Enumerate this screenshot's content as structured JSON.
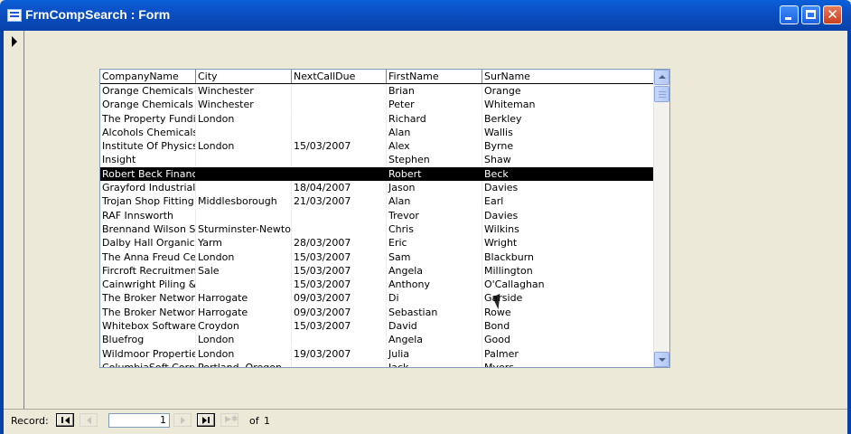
{
  "window": {
    "title": "FrmCompSearch : Form"
  },
  "list": {
    "columns": [
      "CompanyName",
      "City",
      "NextCallDue",
      "FirstName",
      "SurName"
    ],
    "selected_index": 6,
    "rows": [
      [
        "Orange Chemicals",
        "Winchester",
        "",
        "Brian",
        "Orange"
      ],
      [
        "Orange Chemicals",
        "Winchester",
        "",
        "Peter",
        "Whiteman"
      ],
      [
        "The Property Fundi",
        "London",
        "",
        "Richard",
        "Berkley"
      ],
      [
        "Alcohols Chemicals",
        "",
        "",
        "Alan",
        "Wallis"
      ],
      [
        "Institute Of Physics",
        "London",
        "15/03/2007",
        "Alex",
        "Byrne"
      ],
      [
        "Insight",
        "",
        "",
        "Stephen",
        "Shaw"
      ],
      [
        "Robert Beck Financ",
        "",
        "",
        "Robert",
        "Beck"
      ],
      [
        "Grayford Industrial",
        "",
        "18/04/2007",
        "Jason",
        "Davies"
      ],
      [
        "Trojan Shop Fitting",
        "Middlesborough",
        "21/03/2007",
        "Alan",
        "Earl"
      ],
      [
        "RAF Innsworth",
        "",
        "",
        "Trevor",
        "Davies"
      ],
      [
        "Brennand Wilson Sc",
        "Sturminster-Newton",
        "",
        "Chris",
        "Wilkins"
      ],
      [
        "Dalby Hall Organic I",
        "Yarm",
        "28/03/2007",
        "Eric",
        "Wright"
      ],
      [
        "The Anna Freud Ce",
        "London",
        "15/03/2007",
        "Sam",
        "Blackburn"
      ],
      [
        "Fircroft Recruitmen",
        "Sale",
        "15/03/2007",
        "Angela",
        "Millington"
      ],
      [
        "Cainwright Piling &",
        "",
        "15/03/2007",
        "Anthony",
        "O'Callaghan"
      ],
      [
        "The Broker Networl",
        "Harrogate",
        "09/03/2007",
        "Di",
        "Garside"
      ],
      [
        "The Broker Networl",
        "Harrogate",
        "09/03/2007",
        "Sebastian",
        "Rowe"
      ],
      [
        "Whitebox Software",
        "Croydon",
        "15/03/2007",
        "David",
        "Bond"
      ],
      [
        "Bluefrog",
        "London",
        "",
        "Angela",
        "Good"
      ],
      [
        "Wildmoor Propertie",
        "London",
        "19/03/2007",
        "Julia",
        "Palmer"
      ],
      [
        "ColumbiaSoft Corpo",
        "Portland, Oregon",
        "",
        "Jack",
        "Myers"
      ]
    ]
  },
  "navigation": {
    "label": "Record:",
    "current": "1",
    "of_label": "of",
    "total": "1"
  },
  "colors": {
    "title_bar": "#0b4fc4",
    "form_background": "#ece9d8",
    "selected_row": "#000000"
  },
  "icons": {
    "window": "form-icon",
    "minimize": "minimize-icon",
    "maximize": "maximize-icon",
    "close": "close-icon",
    "record_selector": "record-pointer-icon"
  }
}
